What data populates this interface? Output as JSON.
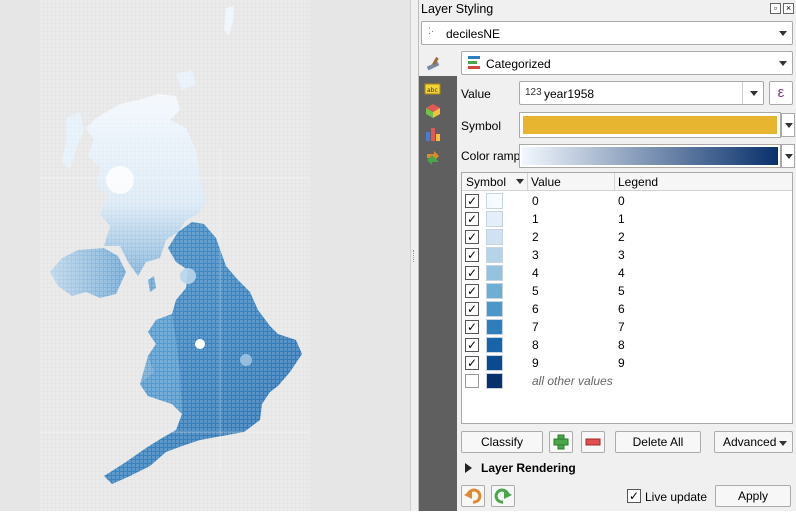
{
  "panel": {
    "title": "Layer Styling",
    "layer_name": "decilesNE",
    "renderer": "Categorized",
    "value_label": "Value",
    "value_type_badge": "123",
    "value_field": "year1958",
    "symbol_label": "Symbol",
    "symbol_color": "#e8b530",
    "color_ramp_label": "Color ramp",
    "ramp_start": "#f2f7fd",
    "ramp_end": "#08306b"
  },
  "table": {
    "headers": [
      "Symbol",
      "Value",
      "Legend"
    ],
    "rows": [
      {
        "checked": true,
        "value": "0",
        "legend": "0",
        "color": "#f7fbff"
      },
      {
        "checked": true,
        "value": "1",
        "legend": "1",
        "color": "#e3eef9"
      },
      {
        "checked": true,
        "value": "2",
        "legend": "2",
        "color": "#cfe1f2"
      },
      {
        "checked": true,
        "value": "3",
        "legend": "3",
        "color": "#b5d4e9"
      },
      {
        "checked": true,
        "value": "4",
        "legend": "4",
        "color": "#93c3df"
      },
      {
        "checked": true,
        "value": "5",
        "legend": "5",
        "color": "#6daed5"
      },
      {
        "checked": true,
        "value": "6",
        "legend": "6",
        "color": "#4b97c9"
      },
      {
        "checked": true,
        "value": "7",
        "legend": "7",
        "color": "#2f7ebc"
      },
      {
        "checked": true,
        "value": "8",
        "legend": "8",
        "color": "#1864aa"
      },
      {
        "checked": true,
        "value": "9",
        "legend": "9",
        "color": "#0a4a90"
      },
      {
        "checked": false,
        "value": "all other values",
        "legend": "",
        "color": "#08306b"
      }
    ]
  },
  "buttons": {
    "classify": "Classify",
    "delete_all": "Delete All",
    "advanced": "Advanced",
    "layer_rendering": "Layer Rendering",
    "live_update": "Live update",
    "apply": "Apply"
  },
  "expression_symbol": "ε",
  "checkmark": "✓",
  "icons": [
    "paintbrush-icon",
    "labels-icon",
    "3d-icon",
    "diagram-icon",
    "history-icon",
    "undo-icon",
    "redo-icon",
    "add-icon",
    "remove-icon"
  ]
}
